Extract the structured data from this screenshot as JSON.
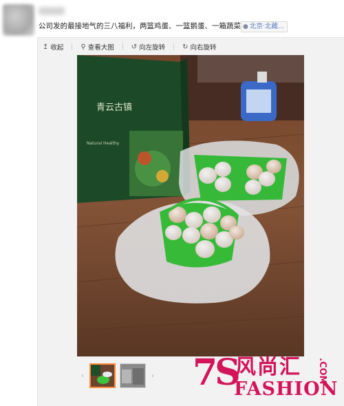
{
  "post": {
    "text": "公司发的最接地气的三八福利，两篮鸡蛋、一篮鹅蛋、一箱蔬菜",
    "location": "北京·北藏..."
  },
  "toolbar": {
    "collapse_label": "收起",
    "view_large_label": "查看大图",
    "rotate_left_label": "向左旋转",
    "rotate_right_label": "向右旋转"
  },
  "photo": {
    "box_text_1": "青云古镇",
    "box_text_2": "Natural Healthy"
  },
  "thumbnails": {
    "count": 2,
    "active_index": 0
  },
  "watermark": {
    "brand_num": "7S",
    "brand_cn": "风尚汇",
    "brand_en": "FASHION",
    "brand_com": ".COM"
  },
  "colors": {
    "accent": "#ff8a3d",
    "watermark": "#d4145a",
    "link": "#5a7dbe"
  }
}
